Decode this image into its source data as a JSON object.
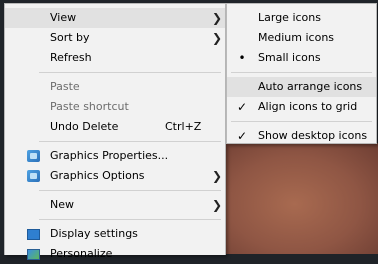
{
  "context_menu": {
    "items": [
      {
        "label": "View",
        "arrow": "❯"
      },
      {
        "label": "Sort by",
        "arrow": "❯"
      },
      {
        "label": "Refresh"
      },
      {
        "label": "Paste"
      },
      {
        "label": "Paste shortcut"
      },
      {
        "label": "Undo Delete",
        "shortcut": "Ctrl+Z"
      },
      {
        "label": "Graphics Properties...",
        "icon": "graphics-icon"
      },
      {
        "label": "Graphics Options",
        "icon": "graphics-icon",
        "arrow": "❯"
      },
      {
        "label": "New",
        "arrow": "❯"
      },
      {
        "label": "Display settings",
        "icon": "display-settings-icon"
      },
      {
        "label": "Personalize",
        "icon": "personalize-icon"
      }
    ]
  },
  "view_submenu": {
    "items": [
      {
        "label": "Large icons"
      },
      {
        "label": "Medium icons"
      },
      {
        "label": "Small icons",
        "mark": "•"
      },
      {
        "label": "Auto arrange icons"
      },
      {
        "label": "Align icons to grid",
        "mark": "✓"
      },
      {
        "label": "Show desktop icons",
        "mark": "✓"
      }
    ]
  }
}
